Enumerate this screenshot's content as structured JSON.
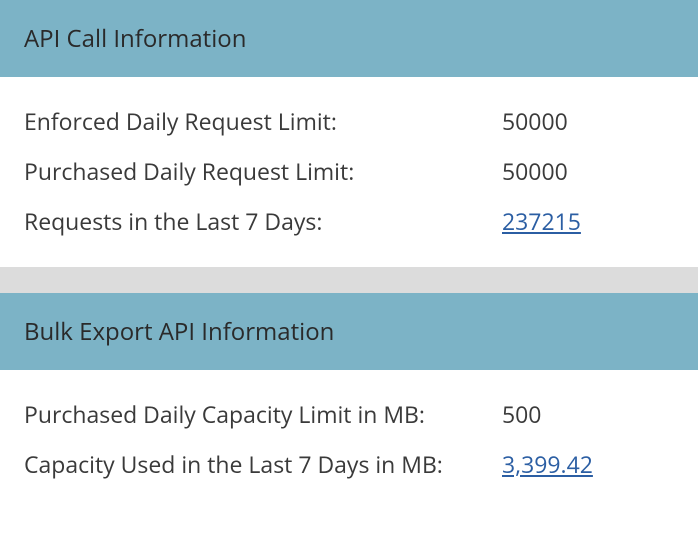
{
  "sections": [
    {
      "title": "API Call Information",
      "rows": [
        {
          "label": "Enforced Daily Request Limit:",
          "value": "50000",
          "link": false
        },
        {
          "label": "Purchased Daily Request Limit:",
          "value": "50000",
          "link": false
        },
        {
          "label": "Requests in the Last 7 Days:",
          "value": "237215",
          "link": true
        }
      ]
    },
    {
      "title": "Bulk Export API Information",
      "rows": [
        {
          "label": "Purchased Daily Capacity Limit in MB:",
          "value": "500",
          "link": false
        },
        {
          "label": "Capacity Used in the Last 7 Days in MB:",
          "value": "3,399.42",
          "link": true
        }
      ]
    }
  ]
}
